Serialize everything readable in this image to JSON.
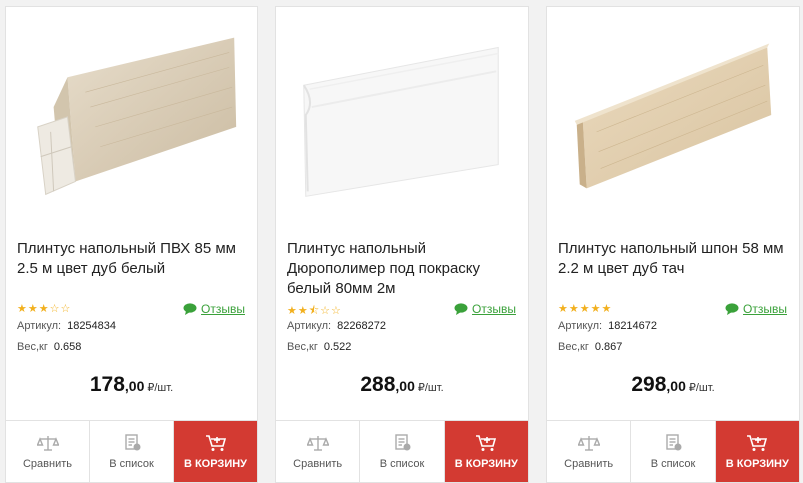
{
  "products": [
    {
      "title": "Плинтус напольный ПВХ 85 мм 2.5 м цвет дуб белый",
      "rating": 3,
      "reviews_label": "Отзывы",
      "article_label": "Артикул:",
      "article": "18254834",
      "weight_label": "Вес,кг",
      "weight": "0.658",
      "price_int": "178",
      "price_dec": ",00",
      "price_unit": "₽/шт.",
      "compare_label": "Сравнить",
      "list_label": "В список",
      "cart_label": "В КОРЗИНУ"
    },
    {
      "title": "Плинтус напольный Дюрополимер под покраску белый 80мм 2м",
      "rating": 2.5,
      "reviews_label": "Отзывы",
      "article_label": "Артикул:",
      "article": "82268272",
      "weight_label": "Вес,кг",
      "weight": "0.522",
      "price_int": "288",
      "price_dec": ",00",
      "price_unit": "₽/шт.",
      "compare_label": "Сравнить",
      "list_label": "В список",
      "cart_label": "В КОРЗИНУ"
    },
    {
      "title": "Плинтус напольный шпон 58 мм 2.2 м цвет дуб тач",
      "rating": 5,
      "reviews_label": "Отзывы",
      "article_label": "Артикул:",
      "article": "18214672",
      "weight_label": "Вес,кг",
      "weight": "0.867",
      "price_int": "298",
      "price_dec": ",00",
      "price_unit": "₽/шт.",
      "compare_label": "Сравнить",
      "list_label": "В список",
      "cart_label": "В КОРЗИНУ"
    }
  ],
  "colors": {
    "cart_button": "#d33a32",
    "stars": "#f2b01e",
    "reviews_link": "#3aa13a"
  },
  "icons": {
    "compare": "scales-icon",
    "list": "list-add-icon",
    "cart": "cart-add-icon",
    "reviews": "chat-bubble-icon"
  }
}
